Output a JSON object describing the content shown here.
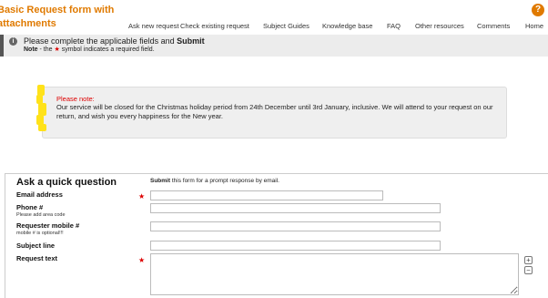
{
  "header": {
    "title_line1": "Basic Request form with",
    "title_line2": "attachments",
    "help_icon": "?",
    "nav": [
      {
        "label": "Ask new request"
      },
      {
        "label": "Check existing request"
      },
      {
        "label": "Subject Guides"
      },
      {
        "label": "Knowledge base"
      },
      {
        "label": "FAQ"
      },
      {
        "label": "Other resources"
      },
      {
        "label": "Comments"
      },
      {
        "label": "Home"
      }
    ]
  },
  "info": {
    "icon": "i",
    "main_prefix": "Please complete the applicable fields and ",
    "main_bold": "Submit",
    "note_bold": "Note",
    "note_pre": " - the ",
    "note_star": "★",
    "note_post": " symbol indicates a required field."
  },
  "notice": {
    "title": "Please note:",
    "text": "Our service will be closed for the Christmas holiday period from 24th December until 3rd January, inclusive.  We will attend to your request on our return, and wish you every happiness for the New year."
  },
  "form": {
    "title": "Ask a quick question",
    "sub_bold": "Submit",
    "sub_rest": " this form for a prompt response by email.",
    "required_star": "★",
    "fields": {
      "email": {
        "label": "Email address",
        "value": ""
      },
      "phone": {
        "label": "Phone #",
        "hint": "Please add area code",
        "value": ""
      },
      "mobile": {
        "label": "Requester mobile #",
        "hint": "mobile # is optional!!!",
        "value": ""
      },
      "subject": {
        "label": "Subject line",
        "value": ""
      },
      "request": {
        "label": "Request text",
        "value": ""
      }
    },
    "expand": "+",
    "shrink": "−"
  },
  "colors": {
    "accent": "#e07a00",
    "required": "#dd0000",
    "highlight": "#ffe21a"
  }
}
